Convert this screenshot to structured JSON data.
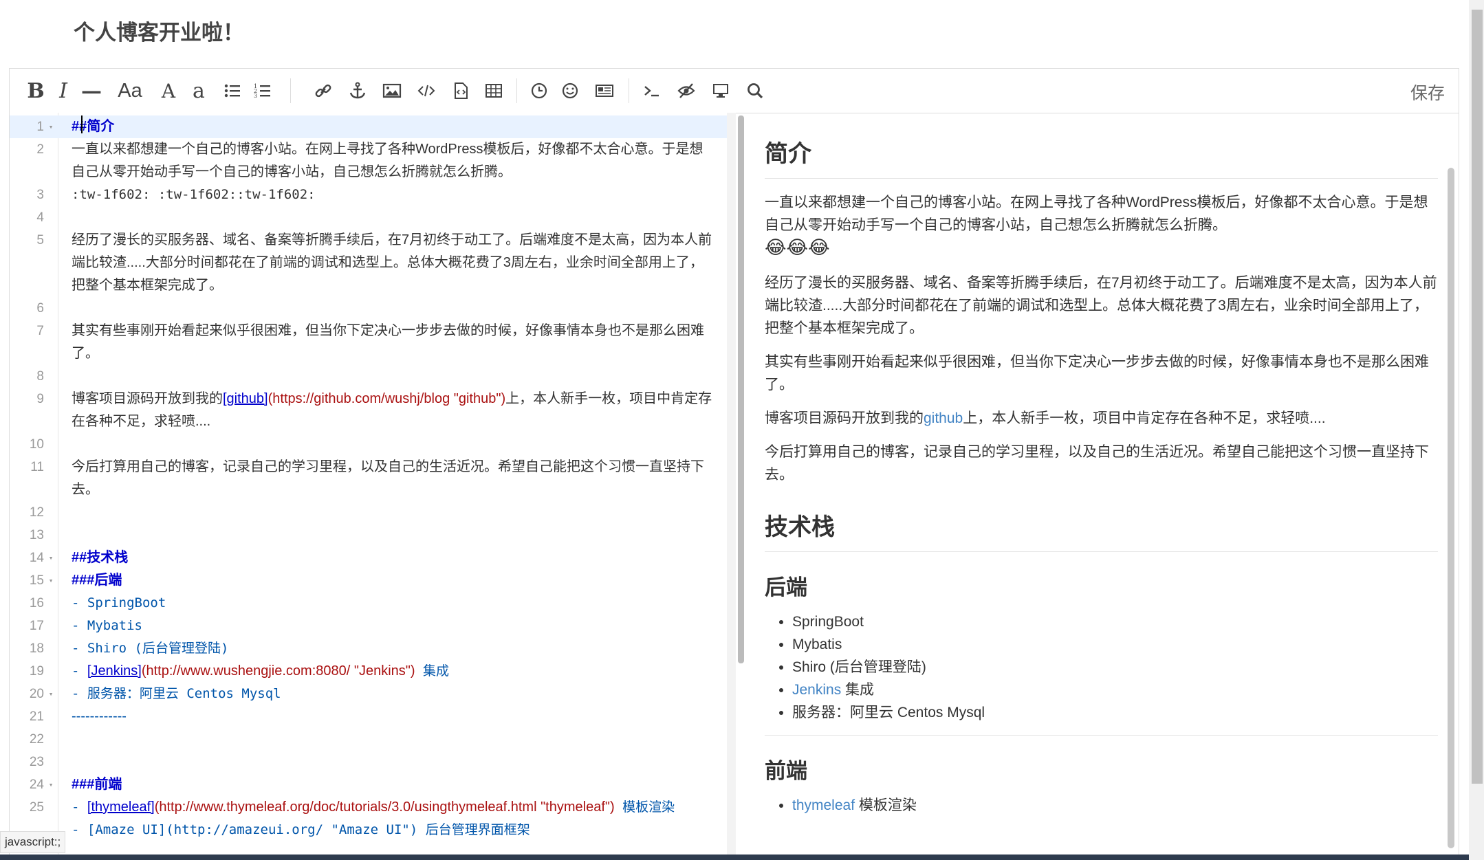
{
  "page": {
    "title": "个人博客开业啦！"
  },
  "toolbar": {
    "buttons": [
      {
        "name": "bold",
        "glyph": "B"
      },
      {
        "name": "italic",
        "glyph": "I"
      },
      {
        "name": "hr",
        "glyph": "—"
      },
      {
        "name": "heading",
        "glyph": "Aa"
      },
      {
        "name": "uppercase",
        "glyph": "A"
      },
      {
        "name": "lowercase",
        "glyph": "a"
      }
    ],
    "save_label": "保存"
  },
  "editor": {
    "lines": [
      {
        "n": "1",
        "fold": "▾",
        "parts": [
          {
            "t": "##简介",
            "c": "c-header"
          }
        ]
      },
      {
        "n": "2",
        "parts": [
          {
            "t": "一直以来都想建一个自己的博客小站。在网上寻找了各种WordPress模板后，好像都不太合心意。于是想自己从零开始动手写一个自己的博客小站，自己想怎么折腾就怎么折腾。",
            "c": ""
          }
        ]
      },
      {
        "n": "3",
        "parts": [
          {
            "t": ":tw-1f602: :tw-1f602::tw-1f602:",
            "c": "c-mono"
          }
        ]
      },
      {
        "n": "4",
        "parts": [
          {
            "t": "",
            "c": ""
          }
        ]
      },
      {
        "n": "5",
        "parts": [
          {
            "t": "经历了漫长的买服务器、域名、备案等折腾手续后，在7月初终于动工了。后端难度不是太高，因为本人前端比较渣.....大部分时间都花在了前端的调试和选型上。总体大概花费了3周左右，业余时间全部用上了，把整个基本框架完成了。",
            "c": ""
          }
        ]
      },
      {
        "n": "6",
        "parts": [
          {
            "t": "",
            "c": ""
          }
        ]
      },
      {
        "n": "7",
        "parts": [
          {
            "t": "其实有些事刚开始看起来似乎很困难，但当你下定决心一步步去做的时候，好像事情本身也不是那么困难了。",
            "c": ""
          }
        ]
      },
      {
        "n": "8",
        "parts": [
          {
            "t": "",
            "c": ""
          }
        ]
      },
      {
        "n": "9",
        "parts": [
          {
            "t": "博客项目源码开放到我的",
            "c": ""
          },
          {
            "t": "[github]",
            "c": "c-link"
          },
          {
            "t": "(https://github.com/wushj/blog \"github\")",
            "c": "c-url"
          },
          {
            "t": "上，本人新手一枚，项目中肯定存在各种不足，求轻喷....",
            "c": ""
          }
        ]
      },
      {
        "n": "10",
        "parts": [
          {
            "t": "",
            "c": ""
          }
        ]
      },
      {
        "n": "11",
        "parts": [
          {
            "t": "今后打算用自己的博客，记录自己的学习里程，以及自己的生活近况。希望自己能把这个习惯一直坚持下去。",
            "c": ""
          }
        ]
      },
      {
        "n": "12",
        "parts": [
          {
            "t": "",
            "c": ""
          }
        ]
      },
      {
        "n": "13",
        "parts": [
          {
            "t": "",
            "c": ""
          }
        ]
      },
      {
        "n": "14",
        "fold": "▾",
        "parts": [
          {
            "t": "##技术栈",
            "c": "c-header"
          }
        ]
      },
      {
        "n": "15",
        "fold": "▾",
        "parts": [
          {
            "t": "###后端",
            "c": "c-header"
          }
        ]
      },
      {
        "n": "16",
        "parts": [
          {
            "t": "- SpringBoot",
            "c": "c-list"
          }
        ]
      },
      {
        "n": "17",
        "parts": [
          {
            "t": "- Mybatis",
            "c": "c-list"
          }
        ]
      },
      {
        "n": "18",
        "parts": [
          {
            "t": "- Shiro (后台管理登陆)",
            "c": "c-list"
          }
        ]
      },
      {
        "n": "19",
        "parts": [
          {
            "t": "- ",
            "c": "c-list"
          },
          {
            "t": "[Jenkins]",
            "c": "c-link"
          },
          {
            "t": "(http://www.wushengjie.com:8080/ \"Jenkins\")",
            "c": "c-url"
          },
          {
            "t": " 集成",
            "c": "c-list"
          }
        ]
      },
      {
        "n": "20",
        "fold": "▾",
        "parts": [
          {
            "t": "- 服务器：阿里云 Centos Mysql",
            "c": "c-list"
          }
        ]
      },
      {
        "n": "21",
        "parts": [
          {
            "t": "------------",
            "c": "c-hr"
          }
        ]
      },
      {
        "n": "22",
        "parts": [
          {
            "t": "",
            "c": ""
          }
        ]
      },
      {
        "n": "23",
        "parts": [
          {
            "t": "",
            "c": ""
          }
        ]
      },
      {
        "n": "24",
        "fold": "▾",
        "parts": [
          {
            "t": "###前端",
            "c": "c-header"
          }
        ]
      },
      {
        "n": "25",
        "parts": [
          {
            "t": "- ",
            "c": "c-list"
          },
          {
            "t": "[thymeleaf]",
            "c": "c-link"
          },
          {
            "t": "(http://www.thymeleaf.org/doc/tutorials/3.0/usingthymeleaf.html \"thymeleaf\")",
            "c": "c-url"
          },
          {
            "t": " 模板渲染",
            "c": "c-list"
          }
        ]
      },
      {
        "n": "",
        "parts": [
          {
            "t": "- [Amaze UI](http://amazeui.org/ \"Amaze UI\") 后台管理界面框架",
            "c": "c-list"
          }
        ]
      }
    ]
  },
  "preview": {
    "h1_intro": "简介",
    "p1": "一直以来都想建一个自己的博客小站。在网上寻找了各种WordPress模板后，好像都不太合心意。于是想自己从零开始动手写一个自己的博客小站，自己想怎么折腾就怎么折腾。",
    "emojis": "😂😂😂",
    "p2": "经历了漫长的买服务器、域名、备案等折腾手续后，在7月初终于动工了。后端难度不是太高，因为本人前端比较渣.....大部分时间都花在了前端的调试和选型上。总体大概花费了3周左右，业余时间全部用上了，把整个基本框架完成了。",
    "p3": "其实有些事刚开始看起来似乎很困难，但当你下定决心一步步去做的时候，好像事情本身也不是那么困难了。",
    "p4_pre": "博客项目源码开放到我的",
    "p4_link": "github",
    "p4_post": "上，本人新手一枚，项目中肯定存在各种不足，求轻喷....",
    "p5": "今后打算用自己的博客，记录自己的学习里程，以及自己的生活近况。希望自己能把这个习惯一直坚持下去。",
    "h1_stack": "技术栈",
    "h2_backend": "后端",
    "backend": [
      "SpringBoot",
      "Mybatis",
      "Shiro (后台管理登陆)"
    ],
    "jenkins_link": "Jenkins",
    "jenkins_suffix": " 集成",
    "server": "服务器：阿里云 Centos Mysql",
    "h2_frontend": "前端",
    "thymeleaf_link": "thymeleaf",
    "thymeleaf_suffix": " 模板渲染"
  },
  "status": {
    "tooltip": "javascript:;"
  }
}
